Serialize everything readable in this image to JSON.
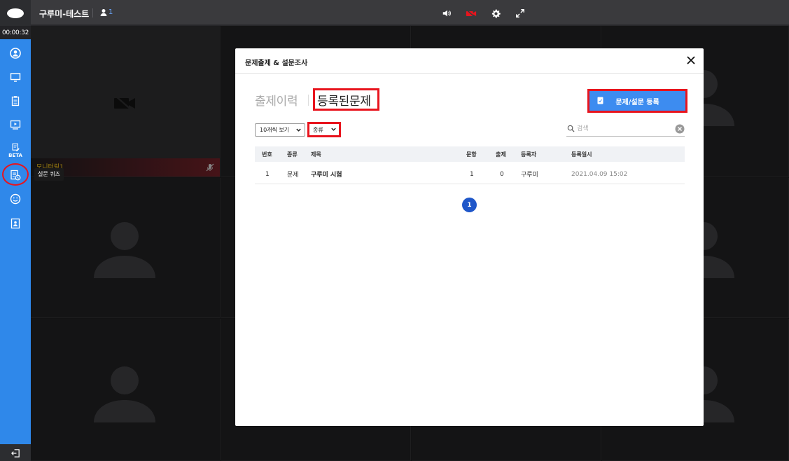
{
  "sidebar": {
    "timer": "00:00:32",
    "beta_label": "BETA",
    "tooltip": "설문 퀴즈",
    "items": [
      {
        "icon": "user-circle-icon"
      },
      {
        "icon": "monitor-icon"
      },
      {
        "icon": "clipboard-icon"
      },
      {
        "icon": "screen-play-icon"
      },
      {
        "icon": "beta-note-icon"
      },
      {
        "icon": "survey-quiz-icon"
      },
      {
        "icon": "smile-icon"
      },
      {
        "icon": "contact-card-icon"
      }
    ],
    "exit_icon": "exit-icon"
  },
  "topbar": {
    "room_title": "구루미-테스트",
    "user_count": "1",
    "controls": [
      "speaker-icon",
      "camera-off-icon",
      "gear-icon",
      "fullscreen-icon"
    ]
  },
  "grid": {
    "tile_name": "모니터링1"
  },
  "modal": {
    "title": "문제출제 & 설문조사",
    "tabs": {
      "history": "출제이력",
      "registered": "등록된문제"
    },
    "register_button": "문제/설문 등록",
    "page_size": "10개씩 보기",
    "type_filter": "종류",
    "search_placeholder": "검색",
    "columns": {
      "no": "번호",
      "type": "종류",
      "title": "제목",
      "questions": "문항",
      "issued": "출제",
      "author": "등록자",
      "date": "등록일시"
    },
    "rows": [
      {
        "no": "1",
        "type": "문제",
        "title": "구루미 시험",
        "questions": "1",
        "issued": "0",
        "author": "구루미",
        "date": "2021.04.09 15:02"
      }
    ],
    "current_page": "1"
  },
  "colors": {
    "sidebar": "#2f88ea",
    "accent_button": "#3d8cf0",
    "highlight_red": "#e8141d",
    "page_active": "#1f57c9",
    "tile_name": "#f0c419"
  }
}
